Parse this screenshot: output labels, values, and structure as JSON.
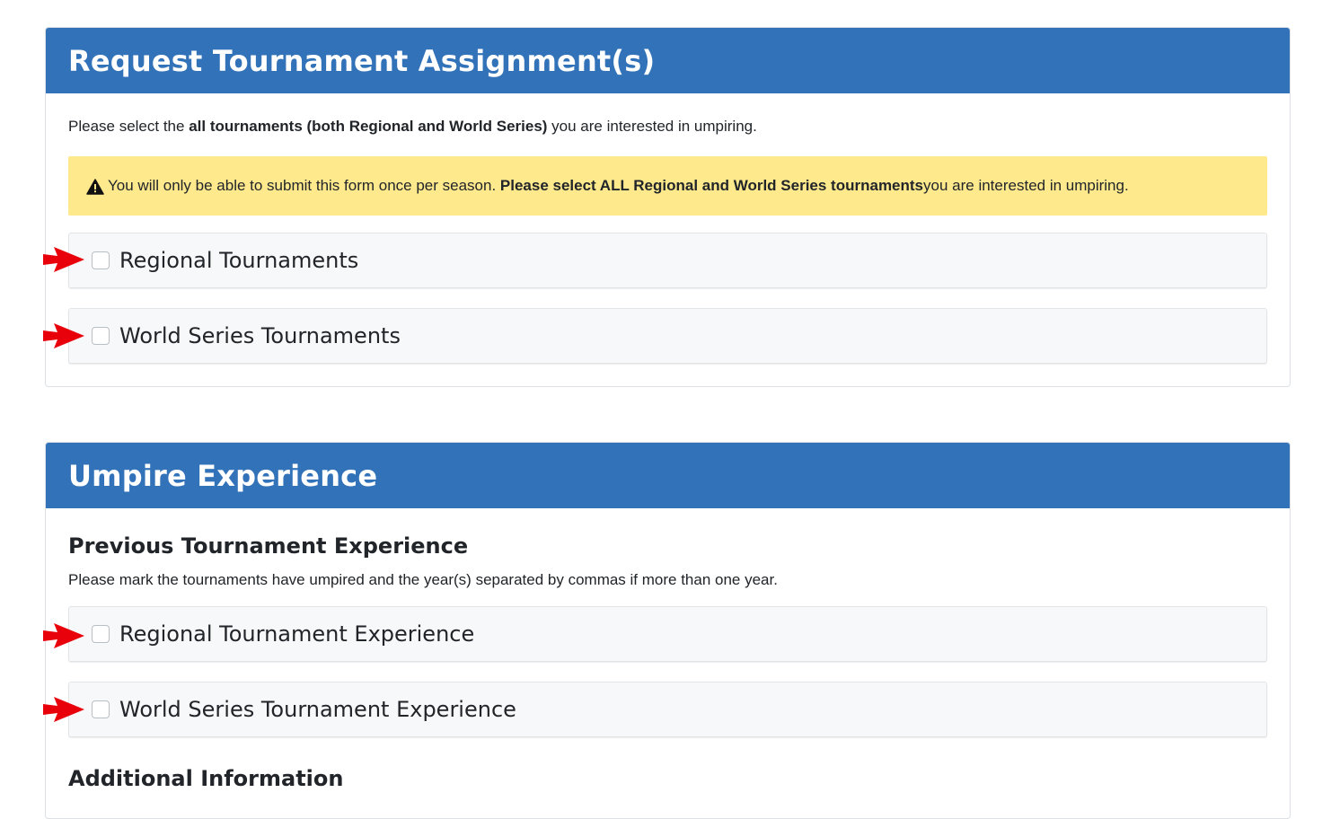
{
  "assignment": {
    "title": "Request Tournament Assignment(s)",
    "intro_prefix": "Please select the ",
    "intro_bold": "all tournaments (both Regional and World Series)",
    "intro_suffix": " you are interested in umpiring.",
    "alert_prefix": "You will only be able to submit this form once per season. ",
    "alert_bold": "Please select ALL Regional and World Series tournaments",
    "alert_suffix": " you are interested in umpiring.",
    "options": [
      {
        "label": "Regional Tournaments",
        "checked": false
      },
      {
        "label": "World Series Tournaments",
        "checked": false
      }
    ]
  },
  "experience": {
    "title": "Umpire Experience",
    "subheading": "Previous Tournament Experience",
    "subtext": "Please mark the tournaments have umpired and the year(s) separated by commas if more than one year.",
    "options": [
      {
        "label": "Regional Tournament Experience",
        "checked": false
      },
      {
        "label": "World Series Tournament Experience",
        "checked": false
      }
    ],
    "additional_heading": "Additional Information"
  },
  "colors": {
    "header_bg": "#3272b8",
    "alert_bg": "#ffe98d",
    "annotation_arrow": "#e8000b"
  },
  "icons": {
    "alert": "warning-triangle-icon",
    "annotation": "red-arrow-icon"
  }
}
